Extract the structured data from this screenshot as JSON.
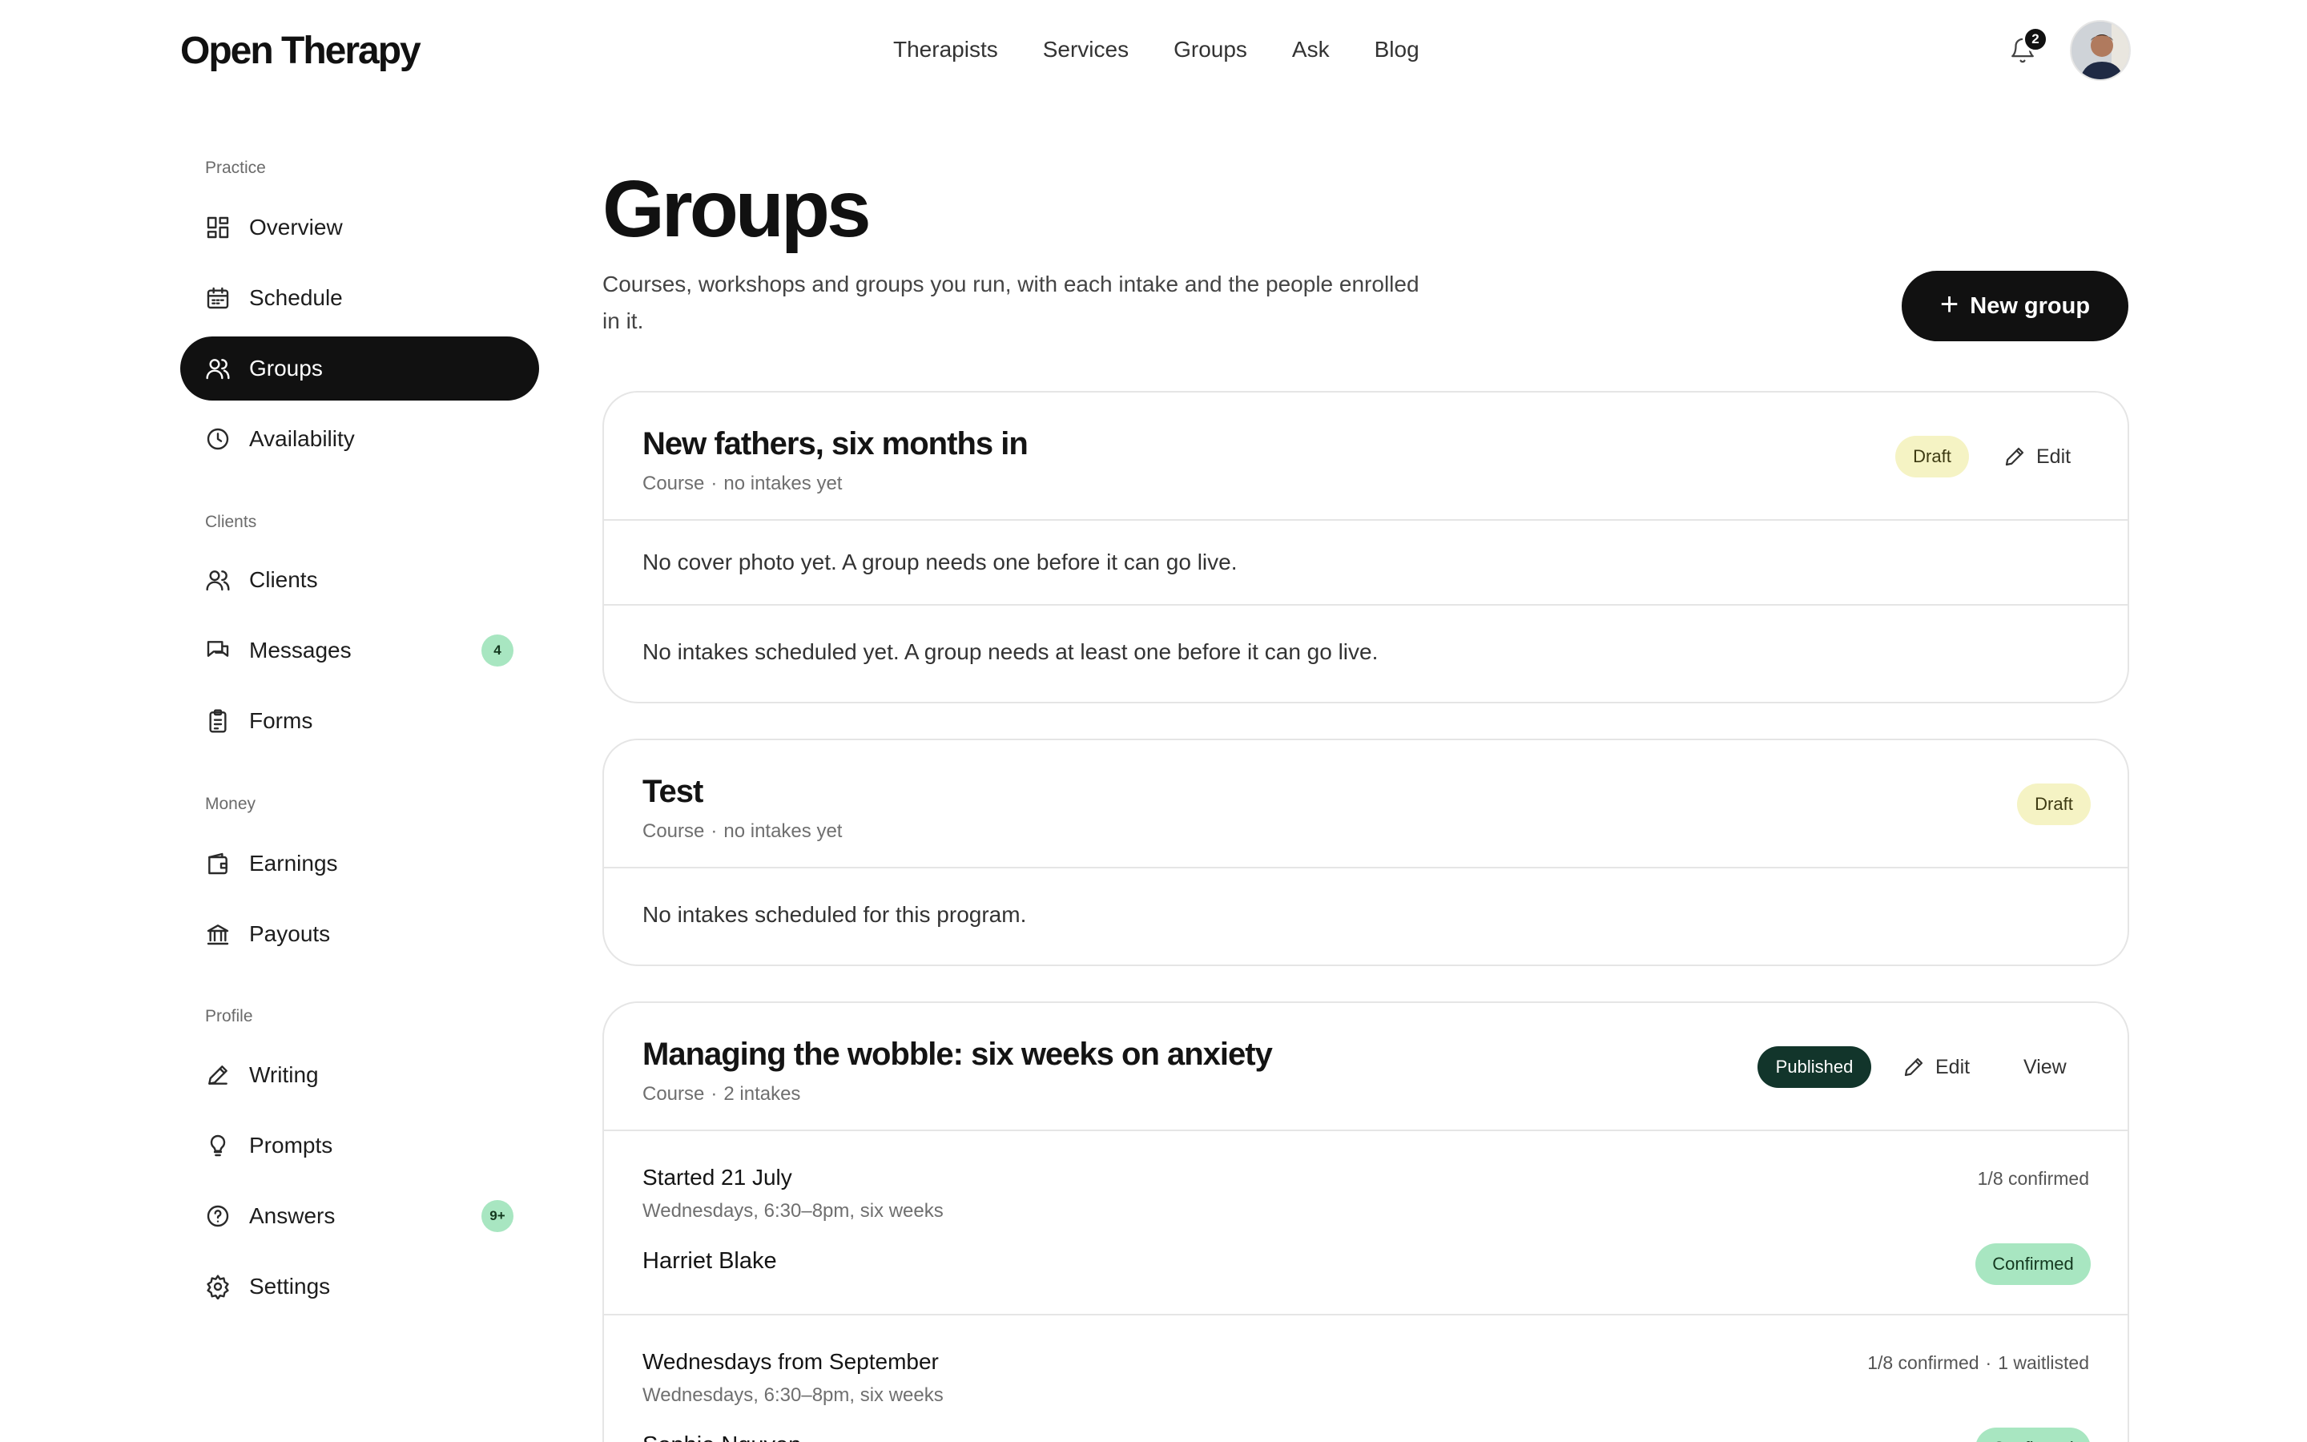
{
  "header": {
    "logo": "Open Therapy",
    "nav": [
      "Therapists",
      "Services",
      "Groups",
      "Ask",
      "Blog"
    ],
    "notification_count": "2",
    "icons": {
      "bell": "bell-icon",
      "avatar": "user-avatar"
    }
  },
  "sidebar": {
    "sections": [
      {
        "label": "Practice",
        "items": [
          {
            "label": "Overview",
            "icon": "grid-icon"
          },
          {
            "label": "Schedule",
            "icon": "calendar-icon"
          },
          {
            "label": "Groups",
            "icon": "users-icon",
            "active": true
          },
          {
            "label": "Availability",
            "icon": "clock-icon"
          }
        ]
      },
      {
        "label": "Clients",
        "items": [
          {
            "label": "Clients",
            "icon": "people-icon"
          },
          {
            "label": "Messages",
            "icon": "chat-icon",
            "badge": "4"
          },
          {
            "label": "Forms",
            "icon": "clipboard-icon"
          }
        ]
      },
      {
        "label": "Money",
        "items": [
          {
            "label": "Earnings",
            "icon": "wallet-icon"
          },
          {
            "label": "Payouts",
            "icon": "bank-icon"
          }
        ]
      },
      {
        "label": "Profile",
        "items": [
          {
            "label": "Writing",
            "icon": "pen-icon"
          },
          {
            "label": "Prompts",
            "icon": "lightbulb-icon"
          },
          {
            "label": "Answers",
            "icon": "question-icon",
            "badge": "9+"
          },
          {
            "label": "Settings",
            "icon": "gear-icon"
          }
        ]
      }
    ]
  },
  "main": {
    "title": "Groups",
    "subtitle": "Courses, workshops and groups you run, with each intake and the people enrolled in it.",
    "new_group_label": "New group",
    "groups": [
      {
        "title": "New fathers, six months in",
        "type": "Course",
        "intakes_summary": "no intakes yet",
        "status": "Draft",
        "edit_label": "Edit",
        "notes": [
          "No cover photo yet. A group needs one before it can go live.",
          "No intakes scheduled yet. A group needs at least one before it can go live."
        ]
      },
      {
        "title": "Test",
        "type": "Course",
        "intakes_summary": "no intakes yet",
        "status": "Draft",
        "notes": [
          "No intakes scheduled for this program."
        ]
      },
      {
        "title": "Managing the wobble: six weeks on anxiety",
        "type": "Course",
        "intakes_summary": "2 intakes",
        "status": "Published",
        "edit_label": "Edit",
        "view_label": "View",
        "intakes": [
          {
            "title": "Started 21 July",
            "schedule": "Wednesdays, 6:30–8pm, six weeks",
            "count": "1/8 confirmed",
            "person": "Harriet Blake",
            "person_status": "Confirmed"
          },
          {
            "title": "Wednesdays from September",
            "schedule": "Wednesdays, 6:30–8pm, six weeks",
            "count": "1/8 confirmed",
            "waitlist": "1 waitlisted",
            "person": "Sophie Nguyen",
            "person_status": "Confirmed"
          }
        ]
      }
    ]
  }
}
